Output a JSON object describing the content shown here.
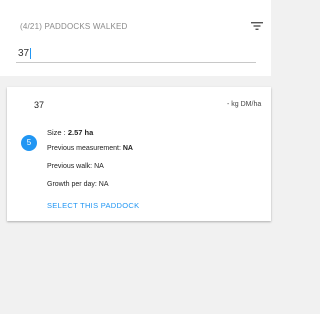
{
  "header": {
    "title": "(4/21) PADDOCKS WALKED",
    "filter_icon": "filter-list-icon"
  },
  "search": {
    "value": "37"
  },
  "paddock_card": {
    "name": "37",
    "growth": "- kg DM/ha",
    "badge": "5",
    "size_label": "Size :",
    "size_value": "2.57 ha",
    "previous_measurement_label": "Previous measurement:",
    "previous_measurement_value": "NA",
    "previous_walk_label": "Previous walk:",
    "previous_walk_value": "NA",
    "growth_per_day_label": "Growth per day:",
    "growth_per_day_value": "NA",
    "select_label": "SELECT THIS PADDOCK"
  },
  "colors": {
    "accent": "#2196f3",
    "background": "#f1f1f1",
    "card": "#ffffff"
  }
}
